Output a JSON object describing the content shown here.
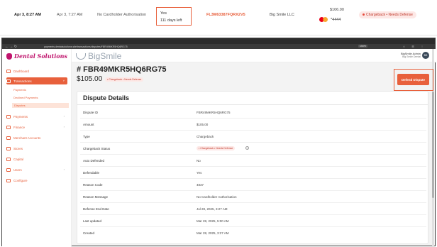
{
  "list_row": {
    "date_opened": "Apr 3, 8:27 AM",
    "date_initiated": "Apr 3, 7:27 AM",
    "reason": "No Cardholder Authorisation",
    "defendable": "Yes",
    "days_left": "111 days left",
    "dispute_id": "FL3M63387FQRX2V5",
    "merchant": "Big Smile LLC",
    "amount": "$106.00",
    "card_last4": "*4444",
    "status": "Chargeback • Needs Defense"
  },
  "browser": {
    "nav_icons": "← → ↻",
    "url": "payments.dentalsolutions.site/transactions/disputes/FBR49MKR5HQ6RG75",
    "zoom": "150%",
    "toolbar_icons": "☆ ☰ ⋮"
  },
  "sidebar": {
    "brand": "Dental Solutions",
    "items": [
      {
        "label": "Dashboard"
      },
      {
        "label": "Transactions",
        "chevron": "˅"
      },
      {
        "label": "Payments",
        "chevron": "›"
      },
      {
        "label": "Finance",
        "chevron": "›"
      },
      {
        "label": "Merchant Accounts"
      },
      {
        "label": "Stores"
      },
      {
        "label": "Capital"
      },
      {
        "label": "Users",
        "chevron": "›"
      },
      {
        "label": "Configure"
      }
    ],
    "subitems": [
      {
        "label": "Payments"
      },
      {
        "label": "Declined Payments"
      },
      {
        "label": "Disputes"
      }
    ]
  },
  "header": {
    "brand": "BigSmile",
    "user_name": "BigSmile Admin",
    "user_role": "Big Smile Dental",
    "avatar_initials": "BS"
  },
  "page": {
    "title": "# FBR49MKR5HQ6RG75",
    "amount": "$105.00",
    "status": "• Chargeback • Needs Defense",
    "defend_button": "Defend Dispute"
  },
  "details": {
    "title": "Dispute Details",
    "rows": [
      {
        "label": "Dispute ID",
        "value": "FBR49MKR5HQ6RG75"
      },
      {
        "label": "Amount",
        "value": "$105.00"
      },
      {
        "label": "Type",
        "value": "Chargeback"
      },
      {
        "label": "Chargeback Status",
        "value": "• Chargeback • Needs Defense",
        "info": "?"
      },
      {
        "label": "Auto Defended",
        "value": "No"
      },
      {
        "label": "Defendable",
        "value": "Yes"
      },
      {
        "label": "Reason Code",
        "value": "4837"
      },
      {
        "label": "Reason Message",
        "value": "No Cardholder Authorisation"
      },
      {
        "label": "Defense End Date",
        "value": "Jul 28, 2025, 3:27 AM"
      },
      {
        "label": "Last updated",
        "value": "Mar 28, 2025, 5:00 AM"
      },
      {
        "label": "Created",
        "value": "Mar 28, 2025, 3:27 AM"
      }
    ]
  },
  "colors": {
    "accent": "#e8603c",
    "brand": "#c0156d",
    "danger": "#c0392b"
  }
}
